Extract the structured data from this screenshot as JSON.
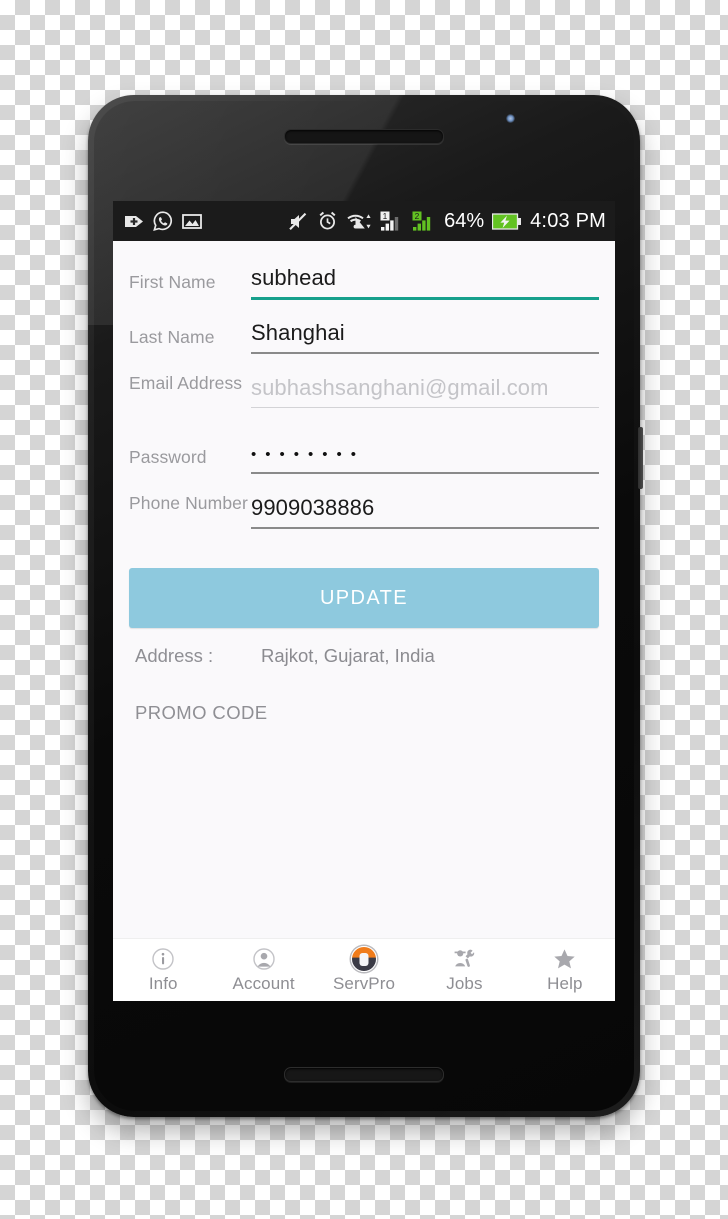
{
  "status_bar": {
    "icons_left": [
      "download-plus-icon",
      "whatsapp-icon",
      "gallery-icon"
    ],
    "icons_right": [
      "mute-icon",
      "alarm-icon",
      "wifi-icon",
      "sim1-signal-icon",
      "sim2-signal-icon"
    ],
    "sim1_label": "1",
    "sim2_label": "2",
    "battery_percent": "64%",
    "battery_state": "charging",
    "time": "4:03 PM"
  },
  "form": {
    "fields": [
      {
        "label": "First Name",
        "value": "subhead",
        "placeholder": "",
        "type": "text",
        "focused": true,
        "disabled": false,
        "two_line": false
      },
      {
        "label": "Last Name",
        "value": "Shanghai",
        "placeholder": "",
        "type": "text",
        "focused": false,
        "disabled": false,
        "two_line": false
      },
      {
        "label": "Email Address",
        "value": "subhashsanghani@gmail.com",
        "placeholder": "",
        "type": "email",
        "focused": false,
        "disabled": true,
        "two_line": true
      },
      {
        "label": "Password",
        "value": "••••••••",
        "placeholder": "",
        "type": "password",
        "focused": false,
        "disabled": false,
        "two_line": false
      },
      {
        "label": "Phone Number",
        "value": "9909038886",
        "placeholder": "",
        "type": "tel",
        "focused": false,
        "disabled": false,
        "two_line": true
      }
    ],
    "update_button_label": "UPDATE",
    "update_button_color": "#8ec9de",
    "focus_underline_color": "#17a08c",
    "address_label": "Address :",
    "address_value": "Rajkot, Gujarat, India",
    "promo_code_label": "PROMO CODE"
  },
  "tabbar": {
    "items": [
      {
        "label": "Info",
        "icon": "info-circle-icon"
      },
      {
        "label": "Account",
        "icon": "person-circle-icon"
      },
      {
        "label": "ServPro",
        "icon": "servpro-logo-icon"
      },
      {
        "label": "Jobs",
        "icon": "worker-wrench-icon"
      },
      {
        "label": "Help",
        "icon": "star-icon"
      }
    ],
    "active": "Account"
  }
}
